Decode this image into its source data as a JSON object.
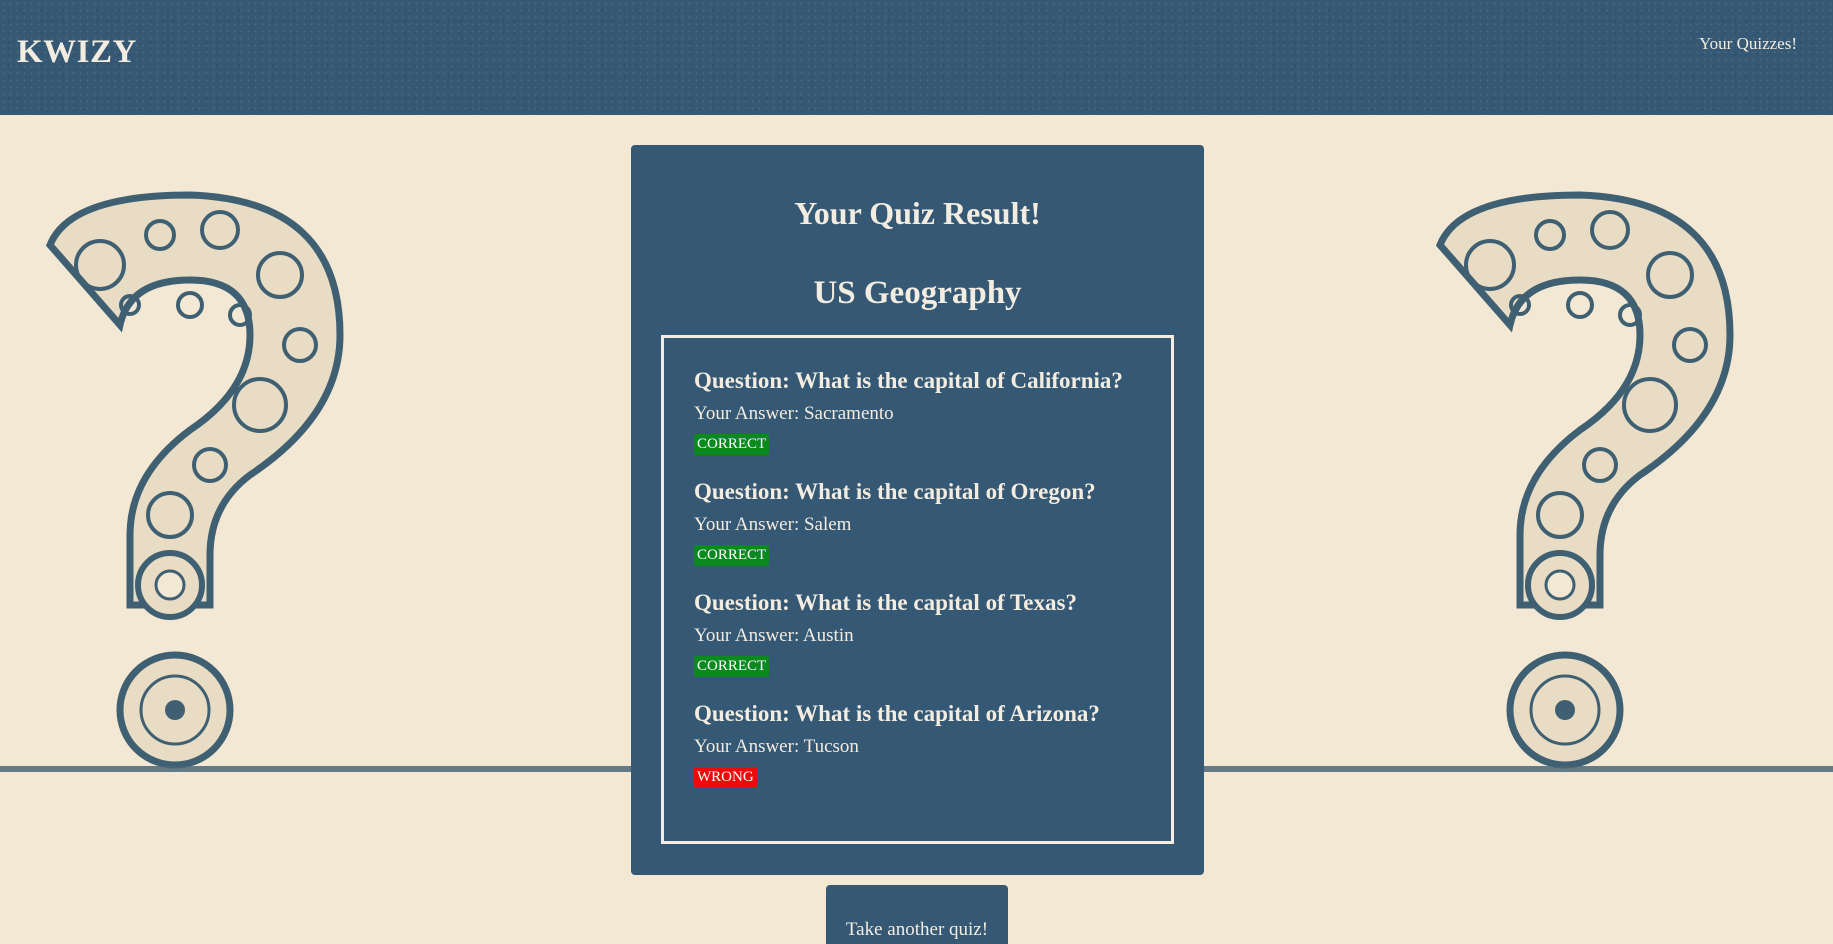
{
  "header": {
    "brand": "KWIZY",
    "nav_link": "Your Quizzes!"
  },
  "card": {
    "title": "Your Quiz Result!",
    "quiz_name": "US Geography",
    "results": [
      {
        "question": "Question: What is the capital of California?",
        "answer": "Your Answer: Sacramento",
        "status": "CORRECT",
        "status_color": "#0a8a1e"
      },
      {
        "question": "Question: What is the capital of Oregon?",
        "answer": "Your Answer: Salem",
        "status": "CORRECT",
        "status_color": "#0a8a1e"
      },
      {
        "question": "Question: What is the capital of Texas?",
        "answer": "Your Answer: Austin",
        "status": "CORRECT",
        "status_color": "#0a8a1e"
      },
      {
        "question": "Question: What is the capital of Arizona?",
        "answer": "Your Answer: Tucson",
        "status": "WRONG",
        "status_color": "#ee0a0a"
      }
    ]
  },
  "actions": {
    "take_another": "Take another quiz!"
  },
  "colors": {
    "primary": "#355874",
    "background": "#f3e8d3",
    "text_light": "#f3ece0"
  }
}
